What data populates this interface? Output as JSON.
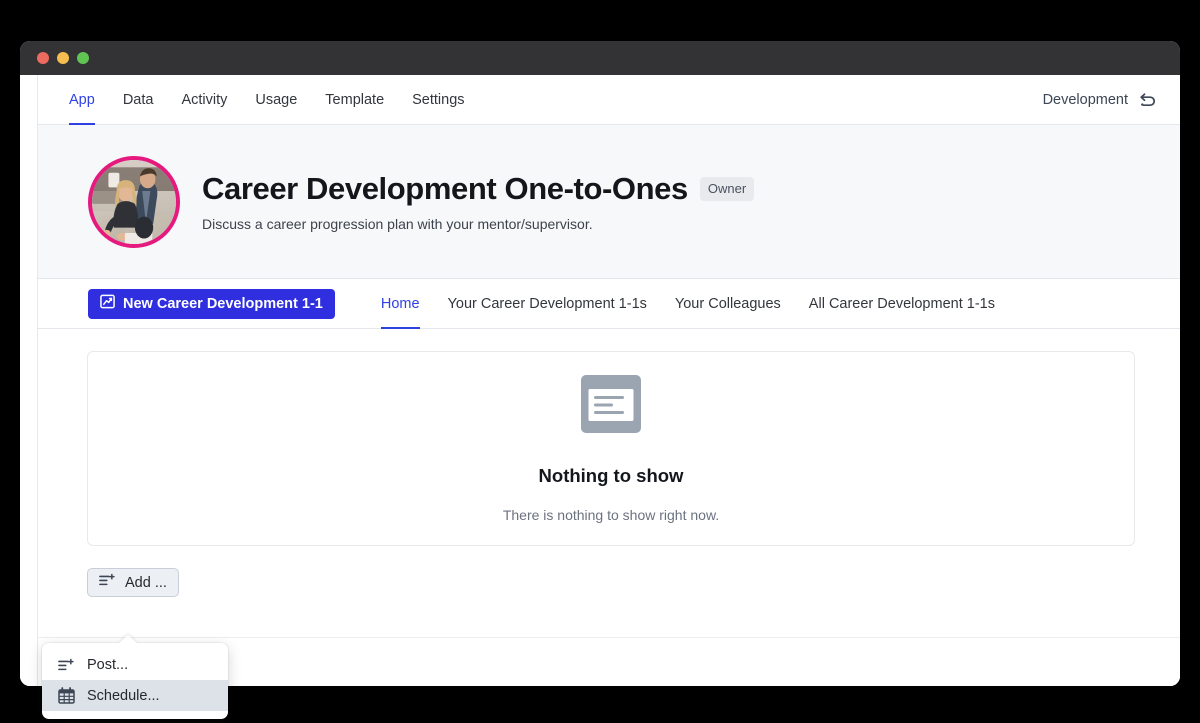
{
  "window": {
    "traffic_lights": [
      "close",
      "minimize",
      "maximize"
    ],
    "colors": {
      "close": "#ec6a5f",
      "minimize": "#f5bd4f",
      "maximize": "#61c554",
      "titlebar": "#333335",
      "accent": "#2f2fe0",
      "avatar_ring": "#e6197e"
    }
  },
  "topnav": {
    "tabs": [
      {
        "label": "App",
        "active": true
      },
      {
        "label": "Data",
        "active": false
      },
      {
        "label": "Activity",
        "active": false
      },
      {
        "label": "Usage",
        "active": false
      },
      {
        "label": "Template",
        "active": false
      },
      {
        "label": "Settings",
        "active": false
      }
    ],
    "environment": "Development",
    "environment_icon": "undo-arrow-icon"
  },
  "app_header": {
    "avatar_icon": "avatar-photo",
    "title": "Career Development One-to-Ones",
    "badge": "Owner",
    "subtitle": "Discuss a career progression plan with your mentor/supervisor."
  },
  "action_bar": {
    "new_button": {
      "label": "New Career Development 1-1",
      "icon": "chart-icon"
    },
    "tabs": [
      {
        "label": "Home",
        "active": true
      },
      {
        "label": "Your Career Development 1-1s",
        "active": false
      },
      {
        "label": "Your Colleagues",
        "active": false
      },
      {
        "label": "All Career Development 1-1s",
        "active": false
      }
    ]
  },
  "main": {
    "empty_state": {
      "icon": "document-placeholder-icon",
      "title": "Nothing to show",
      "subtitle": "There is nothing to show right now."
    },
    "add_button": {
      "label": "Add ...",
      "icon": "list-plus-icon"
    }
  },
  "dropdown": {
    "items": [
      {
        "label": "Post...",
        "icon": "list-plus-icon",
        "hovered": false
      },
      {
        "label": "Schedule...",
        "icon": "calendar-icon",
        "hovered": true
      }
    ]
  }
}
